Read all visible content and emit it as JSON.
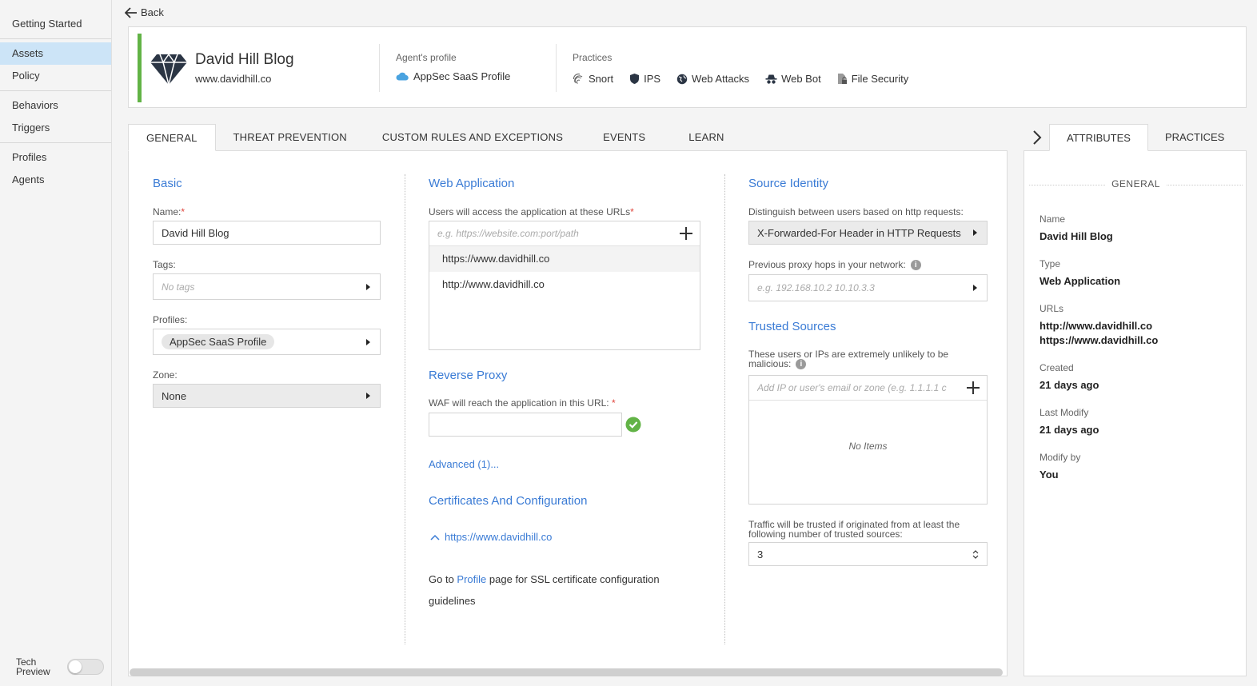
{
  "sidebar": {
    "items": [
      "Getting Started",
      "Assets",
      "Policy",
      "Behaviors",
      "Triggers",
      "Profiles",
      "Agents"
    ],
    "tech_preview": "Tech Preview"
  },
  "back_label": "Back",
  "header": {
    "title": "David Hill Blog",
    "url": "www.davidhill.co",
    "agent_profile_label": "Agent's profile",
    "agent_profile_value": "AppSec SaaS Profile",
    "practices_label": "Practices",
    "practices": [
      "Snort",
      "IPS",
      "Web Attacks",
      "Web Bot",
      "File Security"
    ]
  },
  "tabs": [
    "GENERAL",
    "THREAT PREVENTION",
    "CUSTOM RULES AND EXCEPTIONS",
    "EVENTS",
    "LEARN"
  ],
  "basic": {
    "title": "Basic",
    "name_label": "Name:",
    "name_value": "David Hill Blog",
    "tags_label": "Tags:",
    "tags_placeholder": "No tags",
    "profiles_label": "Profiles:",
    "profile_chip": "AppSec SaaS Profile",
    "zone_label": "Zone:",
    "zone_value": "None"
  },
  "webapp": {
    "title": "Web Application",
    "urls_label": "Users will access the application at these URLs",
    "url_placeholder": "e.g. https://website.com:port/path",
    "urls": [
      "https://www.davidhill.co",
      "http://www.davidhill.co"
    ],
    "reverse_proxy_title": "Reverse Proxy",
    "waf_label": "WAF will reach the application in this URL:",
    "advanced_link": "Advanced (1)...",
    "certs_title": "Certificates And Configuration",
    "cert_url": "https://www.davidhill.co",
    "goto_text": "Go to",
    "profile_link": "Profile",
    "ssl_text": "page for SSL certificate configuration guidelines"
  },
  "source": {
    "title": "Source Identity",
    "distinguish_label": "Distinguish between users based on http requests:",
    "distinguish_value": "X-Forwarded-For Header in HTTP Requests",
    "proxy_label": "Previous proxy hops in your network:",
    "proxy_placeholder": "e.g. 192.168.10.2 10.10.3.3",
    "trusted_title": "Trusted Sources",
    "trusted_label": "These users or IPs are extremely unlikely to be malicious:",
    "trusted_placeholder": "Add IP or user's email or zone (e.g. 1.1.1.1 c",
    "no_items": "No Items",
    "traffic_label": "Traffic will be trusted if originated from at least the following number of trusted sources:",
    "traffic_value": "3"
  },
  "right": {
    "tabs": [
      "ATTRIBUTES",
      "PRACTICES"
    ],
    "section": "GENERAL",
    "name_k": "Name",
    "name_v": "David Hill Blog",
    "type_k": "Type",
    "type_v": "Web Application",
    "urls_k": "URLs",
    "url1": "http://www.davidhill.co",
    "url2": "https://www.davidhill.co",
    "created_k": "Created",
    "created_v": "21 days ago",
    "modified_k": "Last Modify",
    "modified_v": "21 days ago",
    "modby_k": "Modify by",
    "modby_v": "You"
  },
  "colors": {
    "accent": "#3a7bd5",
    "status_green": "#62b346",
    "active_nav": "#cce4f7"
  }
}
